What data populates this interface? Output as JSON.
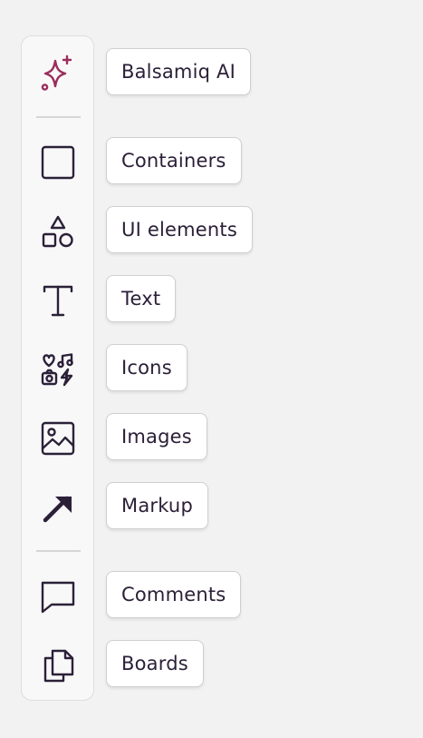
{
  "colors": {
    "accent": "#9b2d5c",
    "icon": "#2b2038",
    "background": "#f2f2f2",
    "toolbar_bg": "#f8f8f8",
    "label_bg": "#ffffff"
  },
  "toolbar": {
    "items": [
      {
        "id": "balsamiq-ai",
        "icon": "sparkle-icon",
        "label": "Balsamiq AI"
      },
      {
        "id": "containers",
        "icon": "square-icon",
        "label": "Containers"
      },
      {
        "id": "ui-elements",
        "icon": "shapes-icon",
        "label": "UI elements"
      },
      {
        "id": "text",
        "icon": "text-icon",
        "label": "Text"
      },
      {
        "id": "icons",
        "icon": "icon-set-icon",
        "label": "Icons"
      },
      {
        "id": "images",
        "icon": "image-icon",
        "label": "Images"
      },
      {
        "id": "markup",
        "icon": "arrow-icon",
        "label": "Markup"
      },
      {
        "id": "comments",
        "icon": "comment-icon",
        "label": "Comments"
      },
      {
        "id": "boards",
        "icon": "copy-pages-icon",
        "label": "Boards"
      }
    ]
  }
}
